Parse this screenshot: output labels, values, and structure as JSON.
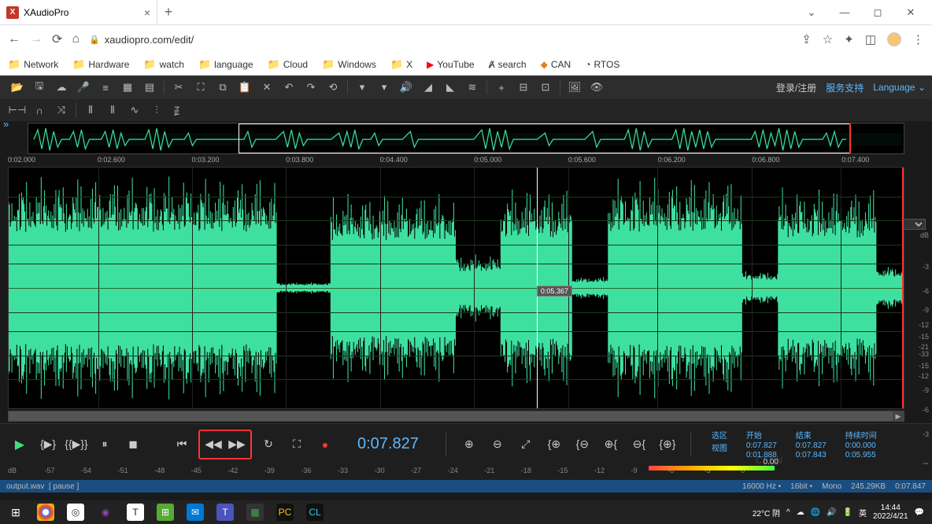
{
  "browser": {
    "tab_title": "XAudioPro",
    "url": "xaudiopro.com/edit/",
    "bookmarks": [
      "Network",
      "Hardware",
      "watch",
      "language",
      "Cloud",
      "Windows",
      "X",
      "YouTube",
      "search",
      "CAN",
      "RTOS"
    ]
  },
  "app": {
    "login": "登录/注册",
    "support": "服务支持",
    "language": "Language",
    "time_ruler": [
      "0:02.000",
      "0:02.600",
      "0:03.200",
      "0:03.800",
      "0:04.400",
      "0:05.000",
      "0:05.600",
      "0:06.200",
      "0:06.800",
      "0:07.400"
    ],
    "db_label": "dB",
    "db_scale": [
      "dB",
      "-3",
      "-6",
      "-9",
      "-12",
      "-15",
      "-21",
      "-33",
      "-15",
      "-12",
      "-9",
      "-6",
      "-3",
      "dB"
    ],
    "cursor_time": "0:05.367",
    "display_time": "0:07.827",
    "info": {
      "selection_label": "选区",
      "view_label": "视图",
      "start_label": "开始",
      "end_label": "结束",
      "duration_label": "持续时间",
      "sel_start": "0:07.827",
      "sel_end": "0:07.827",
      "sel_dur": "0:00.000",
      "view_start": "0:01.888",
      "view_end": "0:07.843",
      "view_dur": "0:05.955"
    },
    "meter_ticks": [
      "dB",
      "-57",
      "-54",
      "-51",
      "-48",
      "-45",
      "-42",
      "-39",
      "-36",
      "-33",
      "-30",
      "-27",
      "-24",
      "-21",
      "-18",
      "-15",
      "-12",
      "-9",
      "-6",
      "-3",
      "0"
    ],
    "meter_value": "0.00",
    "status_file": "output.wav",
    "status_state": "[ pause ]",
    "status_rate": "16000 Hz",
    "status_bit": "16bit",
    "status_ch": "Mono",
    "status_size": "245.29KB",
    "status_len": "0:07.847"
  },
  "os": {
    "weather": "22°C 阴",
    "time": "14:44",
    "date": "2022/4/21"
  }
}
